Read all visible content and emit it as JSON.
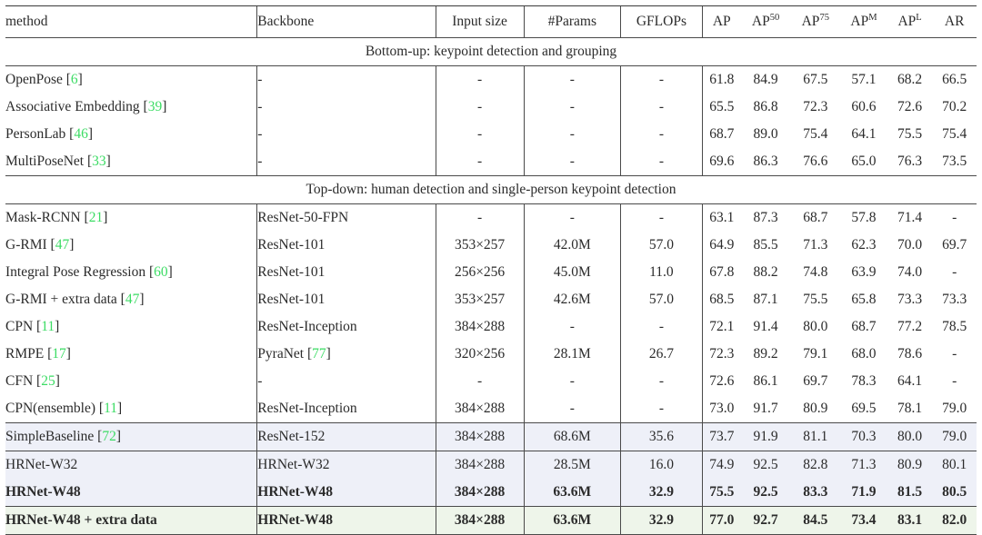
{
  "table": {
    "columns": [
      {
        "key": "method",
        "label": "method"
      },
      {
        "key": "backbone",
        "label": "Backbone"
      },
      {
        "key": "input",
        "label": "Input size"
      },
      {
        "key": "params",
        "label": "#Params"
      },
      {
        "key": "gflops",
        "label": "GFLOPs"
      },
      {
        "key": "ap",
        "label": "AP"
      },
      {
        "key": "ap50",
        "label": "AP",
        "sup": "50"
      },
      {
        "key": "ap75",
        "label": "AP",
        "sup": "75"
      },
      {
        "key": "apm",
        "label": "AP",
        "sup": "M"
      },
      {
        "key": "apl",
        "label": "AP",
        "sup": "L"
      },
      {
        "key": "ar",
        "label": "AR"
      }
    ],
    "sections": [
      {
        "title": "Bottom-up: keypoint detection and grouping",
        "rows": [
          {
            "method": "OpenPose",
            "cite": "6",
            "backbone": "-",
            "input": "-",
            "params": "-",
            "gflops": "-",
            "ap": "61.8",
            "ap50": "84.9",
            "ap75": "67.5",
            "apm": "57.1",
            "apl": "68.2",
            "ar": "66.5"
          },
          {
            "method": "Associative Embedding",
            "cite": "39",
            "backbone": "-",
            "input": "-",
            "params": "-",
            "gflops": "-",
            "ap": "65.5",
            "ap50": "86.8",
            "ap75": "72.3",
            "apm": "60.6",
            "apl": "72.6",
            "ar": "70.2"
          },
          {
            "method": "PersonLab",
            "cite": "46",
            "backbone": "-",
            "input": "-",
            "params": "-",
            "gflops": "-",
            "ap": "68.7",
            "ap50": "89.0",
            "ap75": "75.4",
            "apm": "64.1",
            "apl": "75.5",
            "ar": "75.4"
          },
          {
            "method": "MultiPoseNet",
            "cite": "33",
            "backbone": "-",
            "input": "-",
            "params": "-",
            "gflops": "-",
            "ap": "69.6",
            "ap50": "86.3",
            "ap75": "76.6",
            "apm": "65.0",
            "apl": "76.3",
            "ar": "73.5"
          }
        ]
      },
      {
        "title": "Top-down: human detection and single-person keypoint detection",
        "rows": [
          {
            "method": "Mask-RCNN",
            "cite": "21",
            "backbone": "ResNet-50-FPN",
            "input": "-",
            "params": "-",
            "gflops": "-",
            "ap": "63.1",
            "ap50": "87.3",
            "ap75": "68.7",
            "apm": "57.8",
            "apl": "71.4",
            "ar": "-"
          },
          {
            "method": "G-RMI",
            "cite": "47",
            "backbone": "ResNet-101",
            "input": "353×257",
            "params": "42.0M",
            "gflops": "57.0",
            "ap": "64.9",
            "ap50": "85.5",
            "ap75": "71.3",
            "apm": "62.3",
            "apl": "70.0",
            "ar": "69.7"
          },
          {
            "method": "Integral Pose Regression",
            "cite": "60",
            "backbone": "ResNet-101",
            "input": "256×256",
            "params": "45.0M",
            "gflops": "11.0",
            "ap": "67.8",
            "ap50": "88.2",
            "ap75": "74.8",
            "apm": "63.9",
            "apl": "74.0",
            "ar": "-"
          },
          {
            "method": "G-RMI + extra data",
            "cite": "47",
            "backbone": "ResNet-101",
            "input": "353×257",
            "params": "42.6M",
            "gflops": "57.0",
            "ap": "68.5",
            "ap50": "87.1",
            "ap75": "75.5",
            "apm": "65.8",
            "apl": "73.3",
            "ar": "73.3"
          },
          {
            "method": "CPN",
            "cite": "11",
            "backbone": "ResNet-Inception",
            "input": "384×288",
            "params": "-",
            "gflops": "-",
            "ap": "72.1",
            "ap50": "91.4",
            "ap75": "80.0",
            "apm": "68.7",
            "apl": "77.2",
            "ar": "78.5"
          },
          {
            "method": "RMPE",
            "cite": "17",
            "backbone": "PyraNet",
            "backbone_cite": "77",
            "input": "320×256",
            "params": "28.1M",
            "gflops": "26.7",
            "ap": "72.3",
            "ap50": "89.2",
            "ap75": "79.1",
            "apm": "68.0",
            "apl": "78.6",
            "ar": "-"
          },
          {
            "method": "CFN",
            "cite": "25",
            "backbone": "-",
            "input": "-",
            "params": "-",
            "gflops": "-",
            "ap": "72.6",
            "ap50": "86.1",
            "ap75": "69.7",
            "apm": "78.3",
            "apl": "64.1",
            "ar": "-"
          },
          {
            "method": "CPN(ensemble)",
            "cite": "11",
            "backbone": "ResNet-Inception",
            "input": "384×288",
            "params": "-",
            "gflops": "-",
            "ap": "73.0",
            "ap50": "91.7",
            "ap75": "80.9",
            "apm": "69.5",
            "apl": "78.1",
            "ar": "79.0"
          },
          {
            "method": "SimpleBaseline",
            "cite": "72",
            "backbone": "ResNet-152",
            "input": "384×288",
            "params": "68.6M",
            "gflops": "35.6",
            "ap": "73.7",
            "ap50": "91.9",
            "ap75": "81.1",
            "apm": "70.3",
            "apl": "80.0",
            "ar": "79.0",
            "highlight": "blue",
            "rule_above": true,
            "rule_below": true
          },
          {
            "method": "HRNet-W32",
            "cite": "",
            "backbone": "HRNet-W32",
            "input": "384×288",
            "params": "28.5M",
            "gflops": "16.0",
            "ap": "74.9",
            "ap50": "92.5",
            "ap75": "82.8",
            "apm": "71.3",
            "apl": "80.9",
            "ar": "80.1",
            "highlight": "blue"
          },
          {
            "method": "HRNet-W48",
            "cite": "",
            "backbone": "HRNet-W48",
            "input": "384×288",
            "params": "63.6M",
            "gflops": "32.9",
            "ap": "75.5",
            "ap50": "92.5",
            "ap75": "83.3",
            "apm": "71.9",
            "apl": "81.5",
            "ar": "80.5",
            "highlight": "blue",
            "bold_metrics": true,
            "rule_below": true
          },
          {
            "method": "HRNet-W48 + extra data",
            "cite": "",
            "backbone": "HRNet-W48",
            "input": "384×288",
            "params": "63.6M",
            "gflops": "32.9",
            "ap": "77.0",
            "ap50": "92.7",
            "ap75": "84.5",
            "apm": "73.4",
            "apl": "83.1",
            "ar": "82.0",
            "highlight": "green",
            "bold_metrics": true,
            "rule_below": true
          }
        ]
      }
    ]
  },
  "colors": {
    "citation_green": "#3cdc64",
    "highlight_blue": "#eef0f8",
    "highlight_green": "#eef5ea",
    "rule": "#4a4a4a",
    "text": "#2b2b2b"
  }
}
